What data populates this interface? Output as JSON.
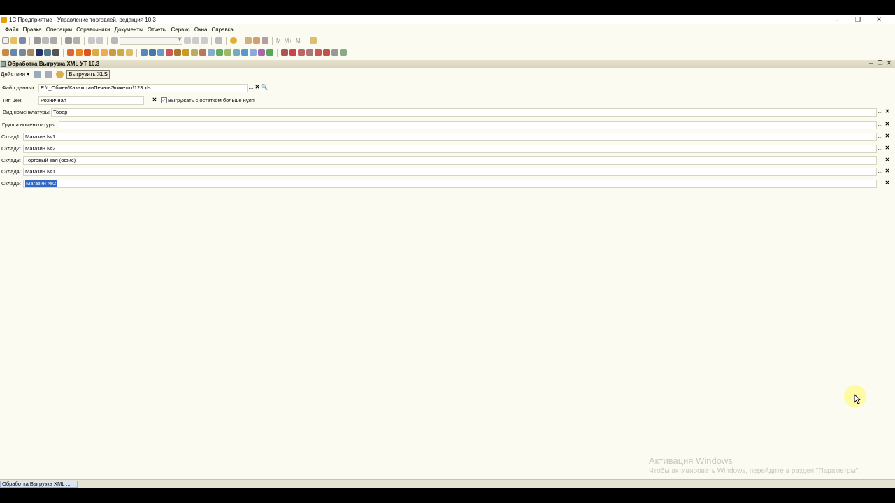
{
  "window": {
    "title": "1С:Предприятие - Управление торговлей, редакция 10.3",
    "controls": [
      "–",
      "❐",
      "✕"
    ]
  },
  "menu": [
    {
      "label": "Файл"
    },
    {
      "label": "Правка"
    },
    {
      "label": "Операции"
    },
    {
      "label": "Справочники"
    },
    {
      "label": "Документы"
    },
    {
      "label": "Отчеты"
    },
    {
      "label": "Сервис"
    },
    {
      "label": "Окна"
    },
    {
      "label": "Справка"
    }
  ],
  "toolbar_text": {
    "m": "М",
    "m_plus": "М+",
    "m_minus": "М-"
  },
  "document": {
    "title": "Обработка  Выгрузка XML  УТ 10.3",
    "controls": [
      "–",
      "❐",
      "✕"
    ]
  },
  "form_toolbar": {
    "actions_label": "Действия ▾",
    "export_button": "Выгрузить XLS"
  },
  "form": {
    "data_file": {
      "label": "Файл данных:",
      "value": "E:\\!_Обмен\\КазахстанПечатьЭтикеток\\123.xls"
    },
    "price_type": {
      "label": "Тип цен:",
      "value": "Розничная"
    },
    "checkbox_positive": {
      "label": "Выгружать с остатком больше нуля",
      "checked": true
    },
    "nomenclature_type": {
      "label": "Вид номенклатуры:",
      "value": "Товар"
    },
    "nomenclature_group": {
      "label": "Группа номенклатуры:",
      "value": ""
    },
    "warehouses": [
      {
        "label": "Склад1:",
        "value": "Магазин №1"
      },
      {
        "label": "Склад2:",
        "value": "Магазин №2"
      },
      {
        "label": "Склад3:",
        "value": "Торговый зал (офис)"
      },
      {
        "label": "Склад4:",
        "value": "Магазин №1"
      },
      {
        "label": "Склад5:",
        "value": "Магазин №2"
      }
    ]
  },
  "buttons": {
    "dots": "...",
    "clear": "✕",
    "search": "🔍"
  },
  "watermark": {
    "title": "Активация Windows",
    "subtitle": "Чтобы активировать Windows, перейдите в раздел \"Параметры\"."
  },
  "window_tab": {
    "label": "Обработка  Выгрузка XML  ..."
  },
  "colors": {
    "background": "#fcfbf1",
    "selection": "#3166c4"
  }
}
